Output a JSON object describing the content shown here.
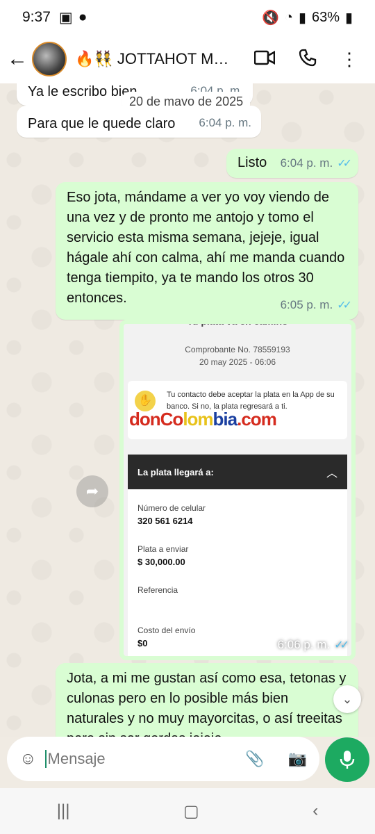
{
  "status": {
    "time": "9:37",
    "battery": "63%"
  },
  "header": {
    "title": "🔥👯 JOTTAHOT MA..."
  },
  "date_chip": "20 de mayo de 2025",
  "messages": [
    {
      "text": "Ya le escribo bien",
      "time": "6:04 p. m."
    },
    {
      "text": "Para que le quede claro",
      "time": "6:04 p. m."
    },
    {
      "text": "Listo",
      "time": "6:04 p. m."
    },
    {
      "text": "Eso jota, mándame a ver yo voy viendo de una vez y de pronto me antojo y tomo el servicio esta misma semana, jejeje, igual hágale ahí con calma, ahí me manda cuando tenga tiempito, ya te mando los otros 30 entonces.",
      "time": "6:05 p. m."
    },
    {
      "text": "Jota, a mi me gustan así como esa, tetonas y culonas pero en lo posible más bien naturales y no muy mayorcitas, o así treeitas pero sin ser gordas jejeje",
      "time": ""
    }
  ],
  "receipt": {
    "top": "Tu plata va en camino",
    "comprobante": "Comprobante No. 78559193",
    "fecha": "20 may 2025 - 06:06",
    "notice": "Tu contacto debe aceptar la plata en la App de su banco. Si no, la plata regresará a ti.",
    "watermark": "donColombia.com",
    "section": "La plata llegará a:",
    "label_cel": "Número de celular",
    "value_cel": "320 561 6214",
    "label_enviar": "Plata a enviar",
    "value_enviar": "$ 30,000.00",
    "label_ref": "Referencia",
    "label_costo": "Costo del envío",
    "value_costo": "$0",
    "time": "6:06 p. m."
  },
  "input": {
    "placeholder": "Mensaje"
  }
}
